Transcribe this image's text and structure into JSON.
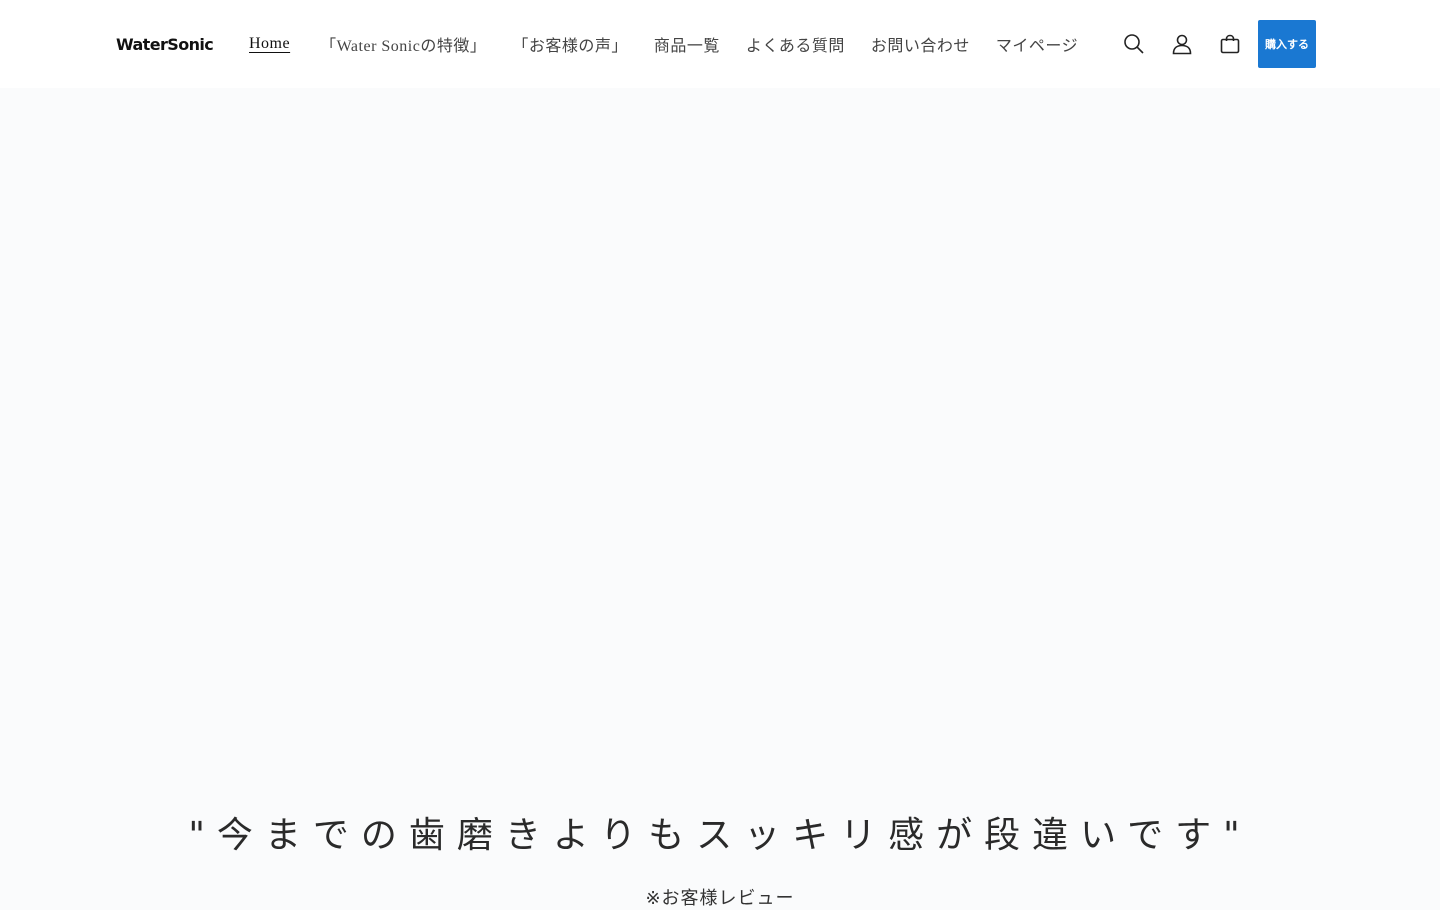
{
  "header": {
    "logo_text": "WaterSonic",
    "nav": [
      {
        "label": "Home",
        "active": true
      },
      {
        "label": "「Water Sonicの特徴」",
        "active": false
      },
      {
        "label": "「お客様の声」",
        "active": false
      },
      {
        "label": "商品一覧",
        "active": false
      },
      {
        "label": "よくある質問",
        "active": false
      },
      {
        "label": "お問い合わせ",
        "active": false
      },
      {
        "label": "マイページ",
        "active": false
      }
    ],
    "icons": {
      "search": "search-icon",
      "account": "user-icon",
      "cart": "cart-icon"
    },
    "buy_label": "購入する",
    "buy_color": "#1a78d2"
  },
  "hero": {
    "headline": "\"今までの歯磨きよりもスッキリ感が段違いです\"",
    "note": "※お客様レビュー"
  }
}
